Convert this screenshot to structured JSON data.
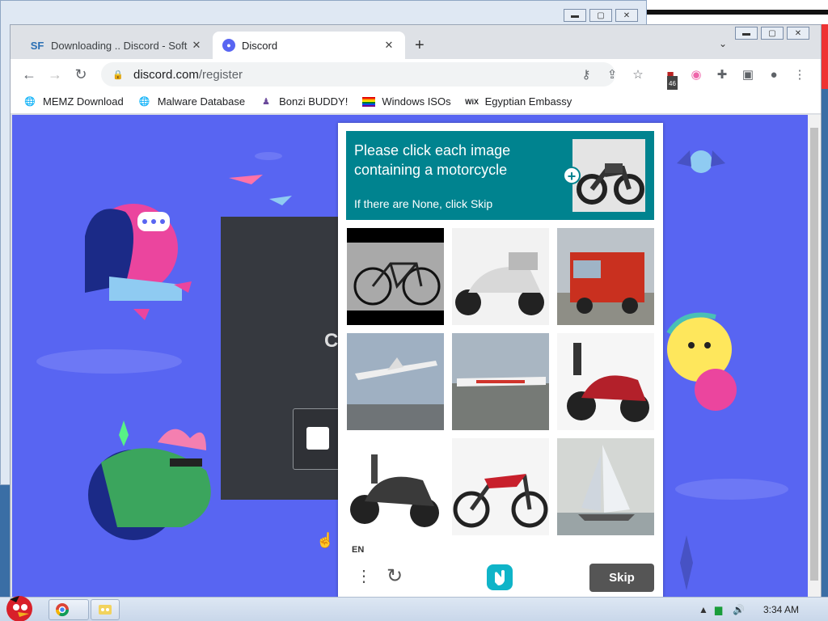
{
  "colors": {
    "discord_bg": "#5865f2",
    "hcaptcha_teal": "#00838f",
    "skip_bg": "#555555"
  },
  "background_window": {
    "buttons": [
      "minimize",
      "maximize",
      "close"
    ]
  },
  "browser": {
    "tabs": [
      {
        "icon": "SF",
        "title": "Downloading .. Discord - Soft",
        "close": "✕"
      },
      {
        "icon": "discord-icon",
        "title": "Discord",
        "close": "✕"
      }
    ],
    "new_tab": "+",
    "tab_menu": "⌄",
    "url_host": "discord.com",
    "url_path": "/register",
    "extension_badge": "46",
    "bookmarks": [
      {
        "icon": "globe-icon",
        "label": "MEMZ Download"
      },
      {
        "icon": "globe-icon",
        "label": "Malware Database"
      },
      {
        "icon": "bonzi-icon",
        "label": "Bonzi BUDDY!"
      },
      {
        "icon": "rainbow-flag-icon",
        "label": "Windows ISOs"
      },
      {
        "icon": "wix-icon",
        "label": "Egyptian Embassy"
      }
    ]
  },
  "discord": {
    "partial_heading": "C"
  },
  "captcha": {
    "prompt": "Please click each image containing a motorcycle",
    "hint": "If there are None, click Skip",
    "tiles": [
      "bicycle",
      "motor-scooter",
      "fire-truck",
      "airplane",
      "airplane-on-runway",
      "motor-scooter-red",
      "motor-scooter-black",
      "dirt-bike",
      "sailboat"
    ],
    "language": "EN",
    "skip_label": "Skip"
  },
  "taskbar": {
    "time": "3:34 AM"
  }
}
